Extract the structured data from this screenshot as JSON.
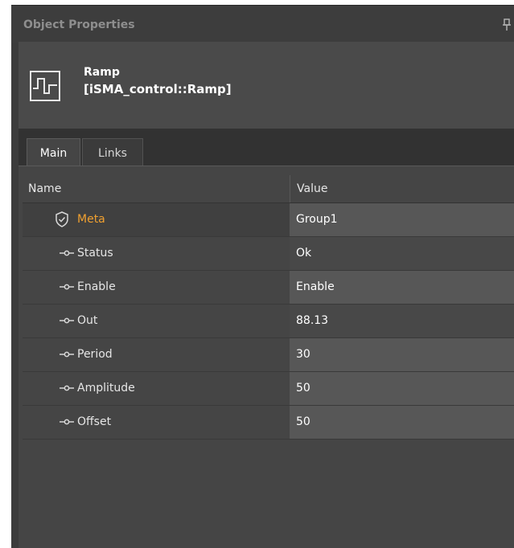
{
  "panel": {
    "title": "Object Properties"
  },
  "object": {
    "name": "Ramp",
    "type": "[iSMA_control::Ramp]"
  },
  "tabs": [
    {
      "label": "Main",
      "active": true
    },
    {
      "label": "Links",
      "active": false
    }
  ],
  "grid": {
    "columns": {
      "name": "Name",
      "value": "Value"
    },
    "rows": [
      {
        "name": "Meta",
        "value": "Group1",
        "icon": "shield-icon"
      },
      {
        "name": "Status",
        "value": "Ok",
        "icon": "slot-icon"
      },
      {
        "name": "Enable",
        "value": "Enable",
        "icon": "slot-icon"
      },
      {
        "name": "Out",
        "value": "88.13",
        "icon": "slot-icon"
      },
      {
        "name": "Period",
        "value": "30",
        "icon": "slot-icon"
      },
      {
        "name": "Amplitude",
        "value": "50",
        "icon": "slot-icon"
      },
      {
        "name": "Offset",
        "value": "50",
        "icon": "slot-icon"
      }
    ]
  },
  "colors": {
    "accent": "#f0a030",
    "panel_bg": "#3c3c3c"
  }
}
